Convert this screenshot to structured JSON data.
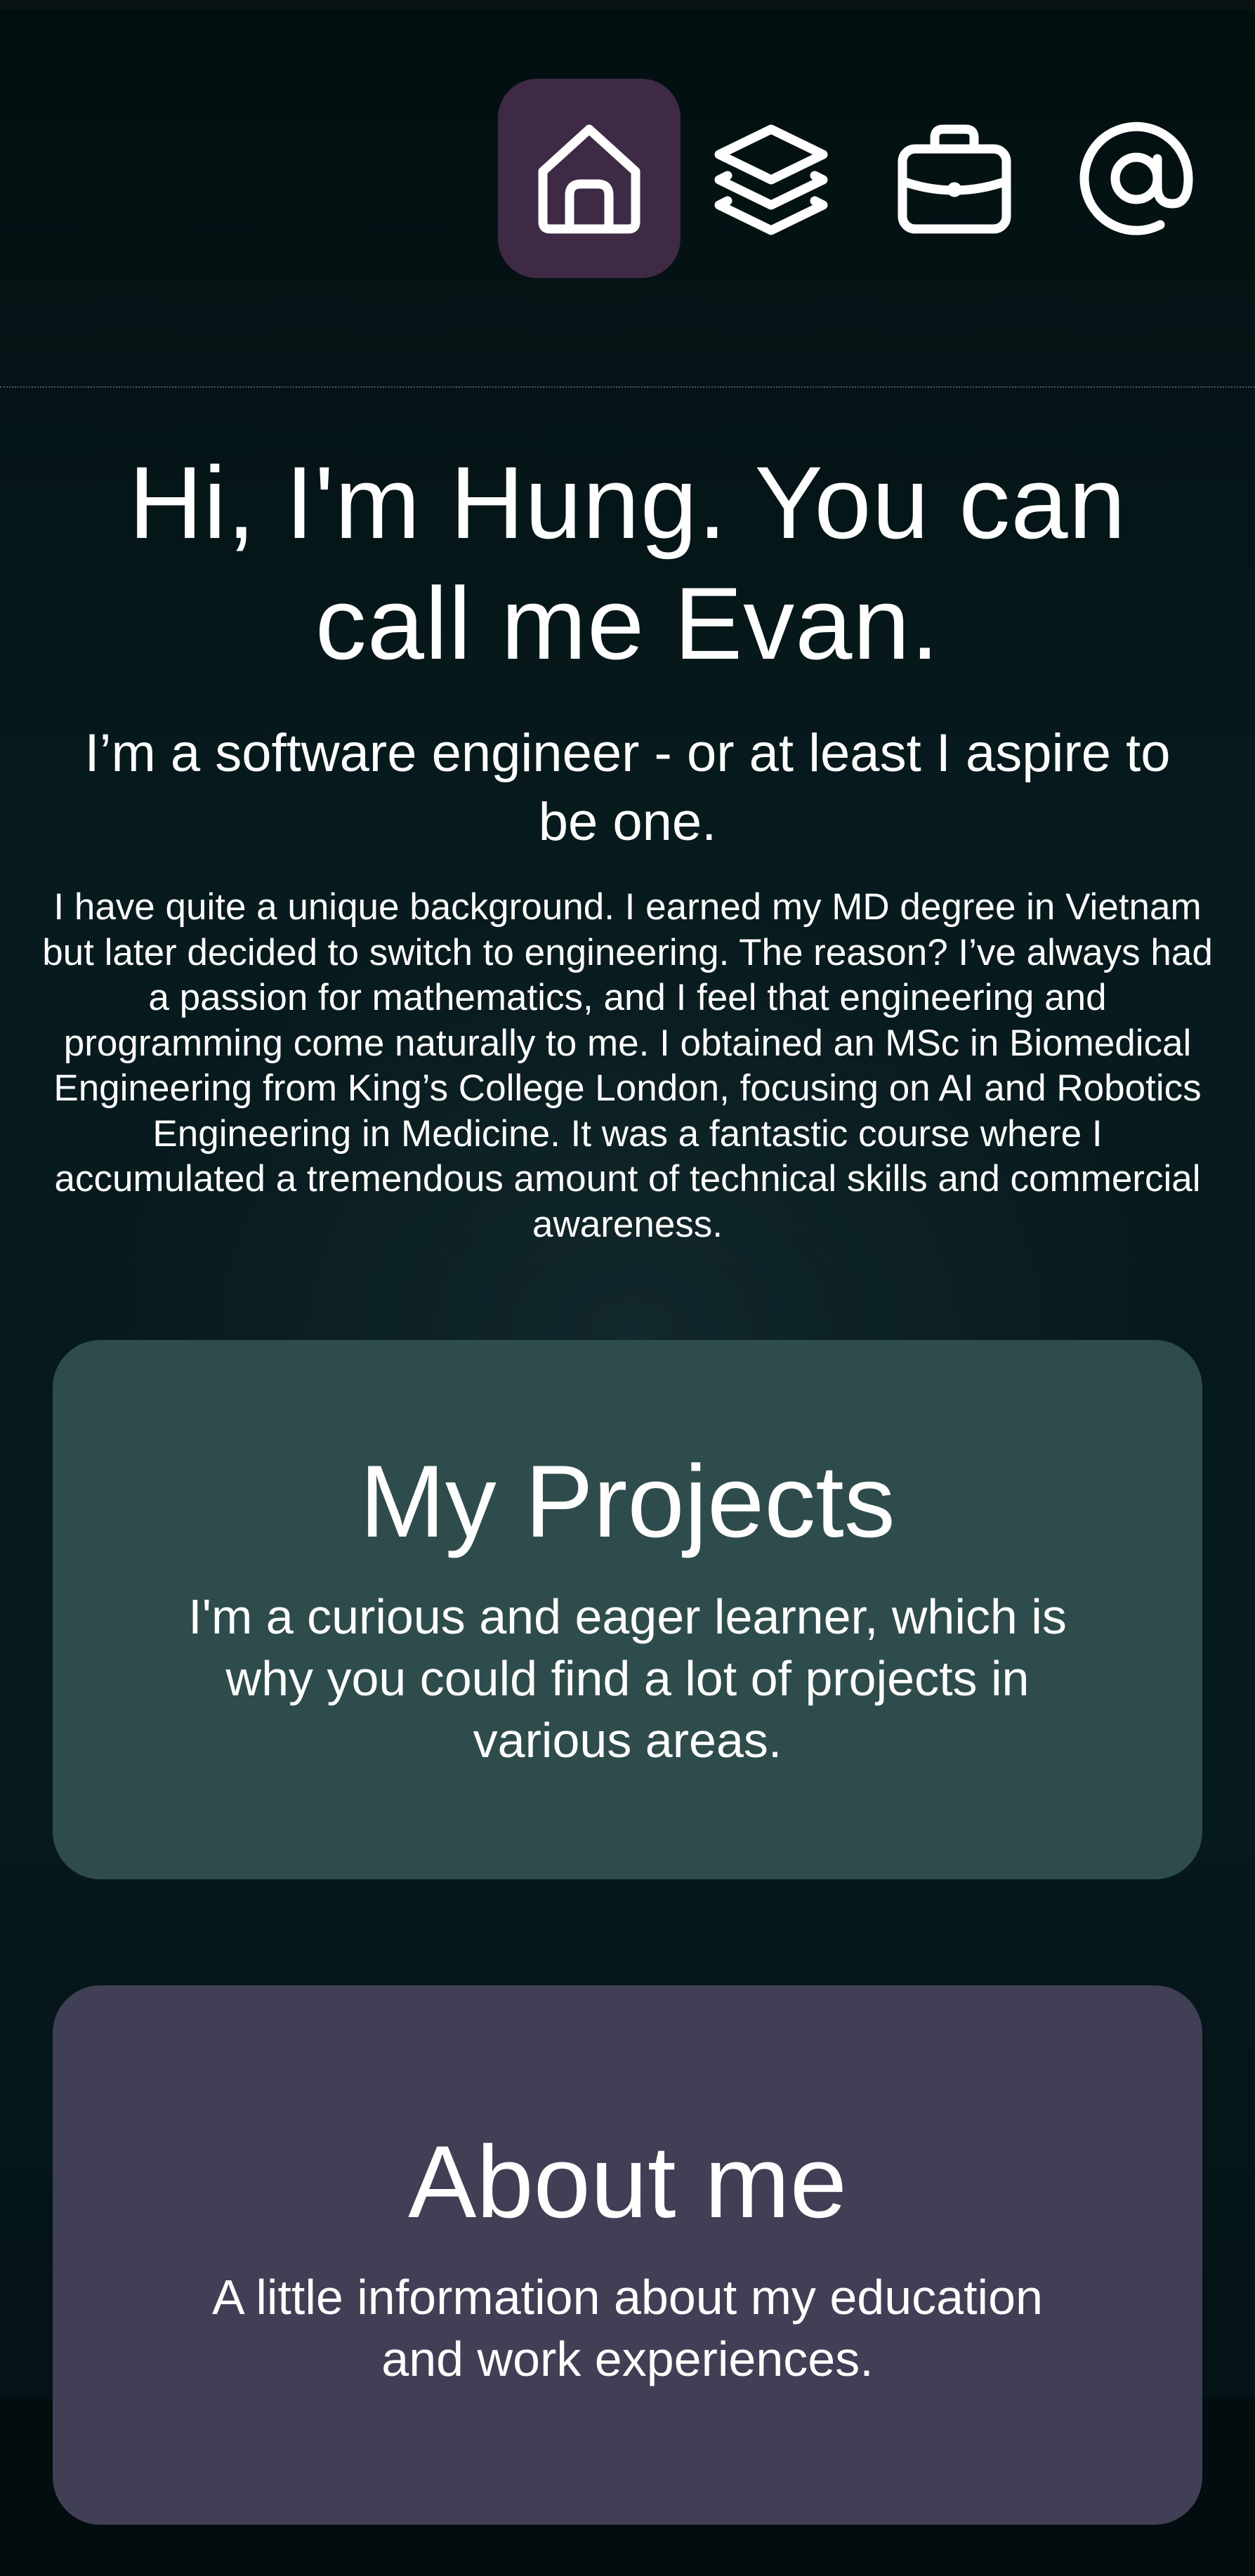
{
  "nav": {
    "items": [
      {
        "icon": "home-icon",
        "active": true
      },
      {
        "icon": "layers-icon",
        "active": false
      },
      {
        "icon": "briefcase-icon",
        "active": false
      },
      {
        "icon": "at-sign-icon",
        "active": false
      }
    ],
    "active_color": "#3e2a44"
  },
  "hero": {
    "title": "Hi, I'm Hung. You can call me Evan.",
    "subtitle": "I’m a software engineer - or at least I aspire to be one.",
    "body": "I have quite a unique background. I earned my MD degree in Vietnam but later decided to switch to engineering. The reason? I’ve always had a passion for mathematics, and I feel that engineering and programming come naturally to me. I obtained an MSc in Biomedical Engineering from King’s College London, focusing on AI and Robotics Engineering in Medicine. It was a fantastic course where I accumulated a tremendous amount of technical skills and commercial awareness."
  },
  "cards": {
    "projects": {
      "title": "My Projects",
      "text": "I'm a curious and eager learner, which is why you could find a lot of projects in various areas.",
      "color": "#2f4c4d"
    },
    "about": {
      "title": "About me",
      "text": "A little information about my education and work experiences.",
      "color": "#403f56"
    }
  },
  "colors": {
    "background": "#031214",
    "text": "#ffffff"
  }
}
